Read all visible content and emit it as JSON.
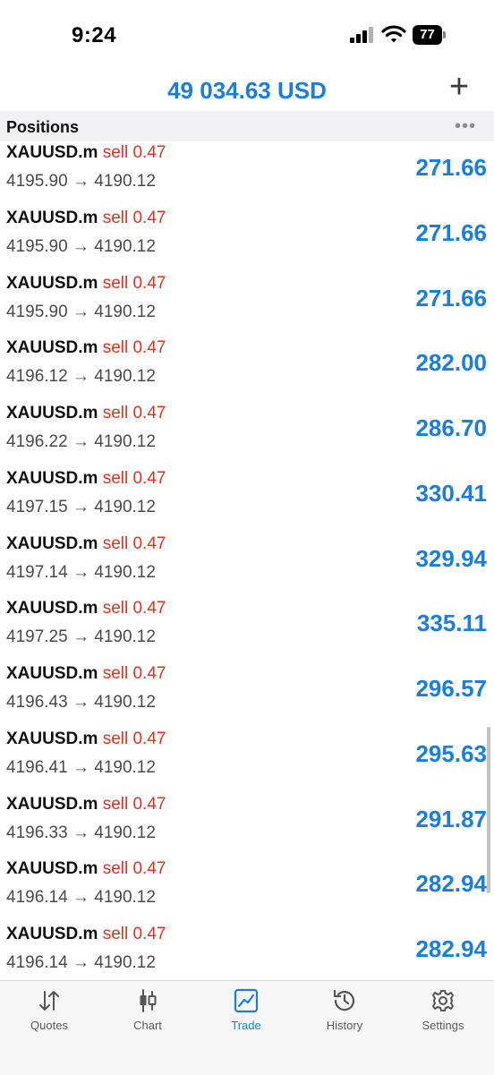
{
  "status_bar": {
    "time": "9:24",
    "battery": "77"
  },
  "header": {
    "balance": "49 034.63 USD",
    "add_icon": "plus-icon"
  },
  "section": {
    "title": "Positions",
    "more_icon": "more-icon"
  },
  "positions": [
    {
      "symbol": "XAUUSD.m",
      "side": "sell 0.47",
      "open": "4195.90",
      "current": "4190.12",
      "profit": "271.66"
    },
    {
      "symbol": "XAUUSD.m",
      "side": "sell 0.47",
      "open": "4195.90",
      "current": "4190.12",
      "profit": "271.66"
    },
    {
      "symbol": "XAUUSD.m",
      "side": "sell 0.47",
      "open": "4195.90",
      "current": "4190.12",
      "profit": "271.66"
    },
    {
      "symbol": "XAUUSD.m",
      "side": "sell 0.47",
      "open": "4196.12",
      "current": "4190.12",
      "profit": "282.00"
    },
    {
      "symbol": "XAUUSD.m",
      "side": "sell 0.47",
      "open": "4196.22",
      "current": "4190.12",
      "profit": "286.70"
    },
    {
      "symbol": "XAUUSD.m",
      "side": "sell 0.47",
      "open": "4197.15",
      "current": "4190.12",
      "profit": "330.41"
    },
    {
      "symbol": "XAUUSD.m",
      "side": "sell 0.47",
      "open": "4197.14",
      "current": "4190.12",
      "profit": "329.94"
    },
    {
      "symbol": "XAUUSD.m",
      "side": "sell 0.47",
      "open": "4197.25",
      "current": "4190.12",
      "profit": "335.11"
    },
    {
      "symbol": "XAUUSD.m",
      "side": "sell 0.47",
      "open": "4196.43",
      "current": "4190.12",
      "profit": "296.57"
    },
    {
      "symbol": "XAUUSD.m",
      "side": "sell 0.47",
      "open": "4196.41",
      "current": "4190.12",
      "profit": "295.63"
    },
    {
      "symbol": "XAUUSD.m",
      "side": "sell 0.47",
      "open": "4196.33",
      "current": "4190.12",
      "profit": "291.87"
    },
    {
      "symbol": "XAUUSD.m",
      "side": "sell 0.47",
      "open": "4196.14",
      "current": "4190.12",
      "profit": "282.94"
    },
    {
      "symbol": "XAUUSD.m",
      "side": "sell 0.47",
      "open": "4196.14",
      "current": "4190.12",
      "profit": "282.94"
    }
  ],
  "arrow": "→",
  "colors": {
    "accent": "#1a7de0",
    "sell": "#e0331f"
  },
  "tabs": [
    {
      "label": "Quotes",
      "icon": "quotes-icon",
      "active": false
    },
    {
      "label": "Chart",
      "icon": "chart-icon",
      "active": false
    },
    {
      "label": "Trade",
      "icon": "trade-icon",
      "active": true
    },
    {
      "label": "History",
      "icon": "history-icon",
      "active": false
    },
    {
      "label": "Settings",
      "icon": "settings-icon",
      "active": false
    }
  ]
}
